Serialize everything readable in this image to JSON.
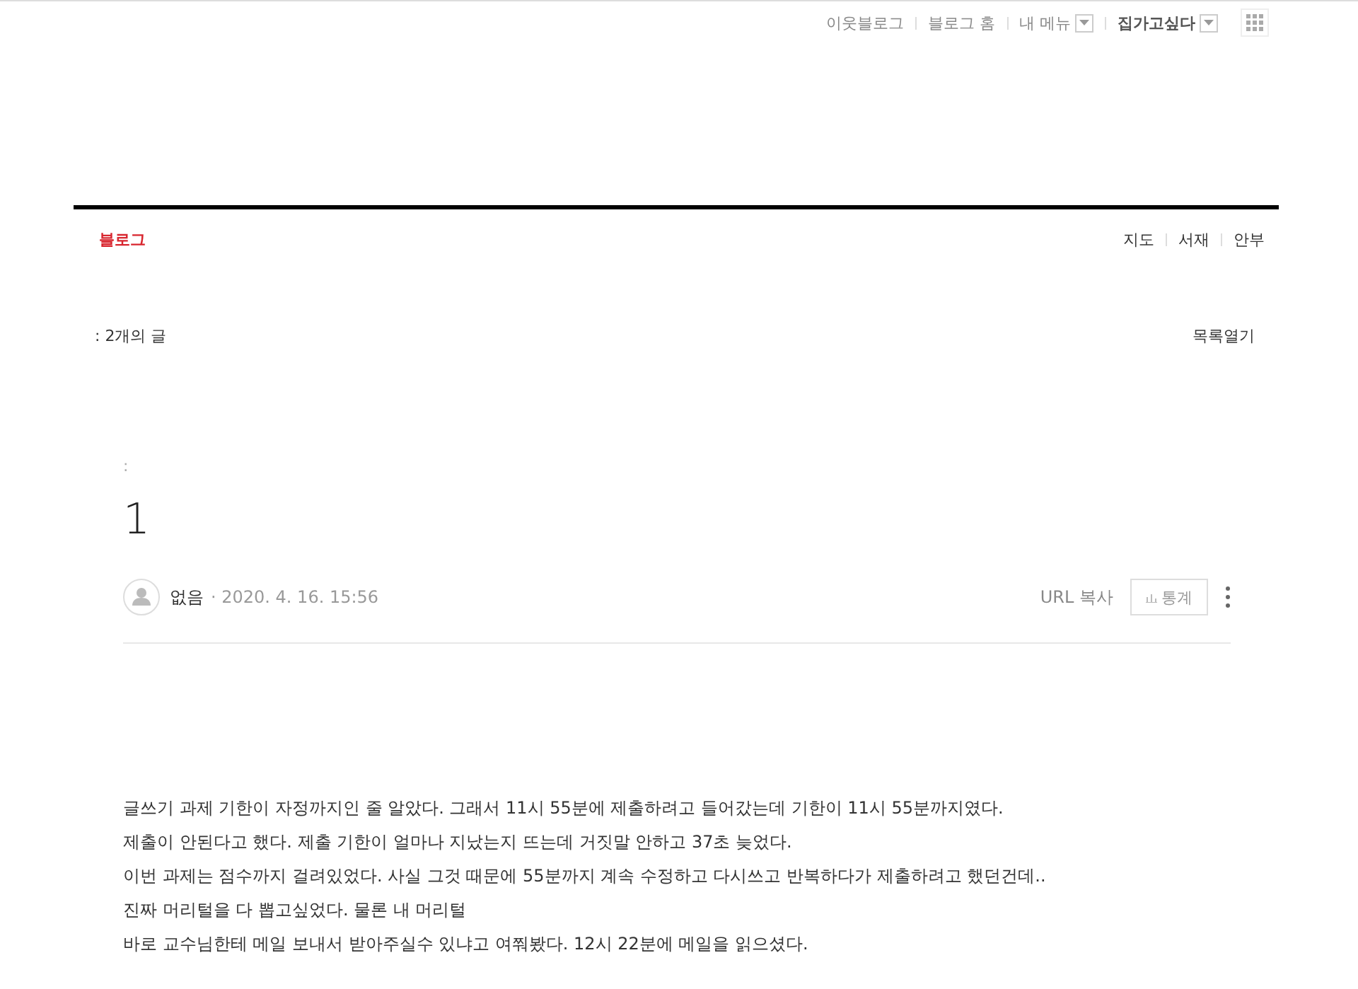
{
  "top_links": [
    "이웃블로그",
    "블로그 홈"
  ],
  "my_menu": {
    "label": "내 메뉴"
  },
  "user": {
    "label": "집가고싶다"
  },
  "blog_title": "블로그",
  "blog_nav": [
    "지도",
    "서재",
    "안부"
  ],
  "post_count": ": 2개의 글",
  "list_toggle": "목록열기",
  "category": ":",
  "post_title": "1",
  "author": "없음",
  "date": "· 2020. 4. 16. 15:56",
  "url_copy": "URL 복사",
  "stats_button": "통계",
  "body": [
    "글쓰기 과제 기한이 자정까지인 줄 알았다. 그래서 11시 55분에 제출하려고 들어갔는데 기한이 11시 55분까지였다.",
    "제출이 안된다고 했다. 제출 기한이 얼마나 지났는지 뜨는데 거짓말 안하고 37초 늦었다.",
    "이번 과제는 점수까지 걸려있었다. 사실 그것 때문에 55분까지 계속 수정하고 다시쓰고 반복하다가 제출하려고 했던건데..",
    "진짜 머리털을 다 뽑고싶었다. 물론 내 머리털",
    "바로 교수님한테 메일 보내서 받아주실수 있냐고 여쭤봤다. 12시 22분에 메일을 읽으셨다."
  ]
}
